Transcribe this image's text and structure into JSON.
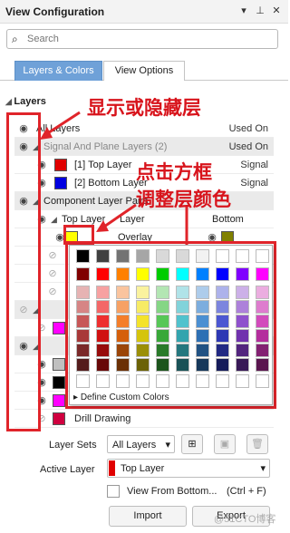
{
  "window": {
    "title": "View Configuration",
    "icons": [
      "chevron-down-icon",
      "pin-icon",
      "close-icon"
    ]
  },
  "search": {
    "placeholder": "Search",
    "value": ""
  },
  "tabs": [
    {
      "label": "Layers & Colors",
      "active": true
    },
    {
      "label": "View Options",
      "active": false
    }
  ],
  "layers_section": {
    "title": "Layers"
  },
  "rows": [
    {
      "label": "All Layers",
      "used_on": "Used On",
      "group": false
    },
    {
      "label": "Signal And Plane Layers (2)",
      "used_on": "Used On",
      "group": true
    },
    {
      "label": "[1] Top Layer",
      "used_on": "Signal",
      "color": "#e00000"
    },
    {
      "label": "[2] Bottom Layer",
      "used_on": "Signal",
      "color": "#0000e0"
    },
    {
      "label": "Component Layer Pairs",
      "group": true
    },
    {
      "label": "Top Layer",
      "col2": "Layer",
      "col3": "Bottom"
    },
    {
      "label": "Overlay",
      "color_left": "#ffff00",
      "color_right": "#808000"
    },
    {
      "label": "Drill Drawing",
      "color": "#d0003f"
    }
  ],
  "color_picker": {
    "custom_label": "Define Custom Colors",
    "top_row": [
      "#000000",
      "#404040",
      "#737373",
      "#a6a6a6",
      "#d9d9d9",
      "#d9d9d9",
      "#f2f2f2",
      "#ffffff",
      "#ffffff"
    ],
    "vivid_row": [
      "#800000",
      "#ff0000",
      "#ff8000",
      "#ffff00",
      "#00cc00",
      "#00ffff",
      "#0080ff",
      "#0000ff",
      "#8000ff",
      "#ff00ff"
    ]
  },
  "annotations": {
    "show_hide": "显示或隐藏层",
    "click_box_1": "点击方框",
    "click_box_2": "调整层颜色"
  },
  "bottom": {
    "layer_sets_label": "Layer Sets",
    "layer_sets_value": "All Layers",
    "active_layer_label": "Active Layer",
    "active_layer_value": "Top Layer",
    "active_layer_color": "#e00000",
    "view_from_bottom_label": "View From Bottom...",
    "shortcut": "(Ctrl + F)",
    "import_label": "Import",
    "export_label": "Export",
    "watermark": "@51CTO博客"
  }
}
